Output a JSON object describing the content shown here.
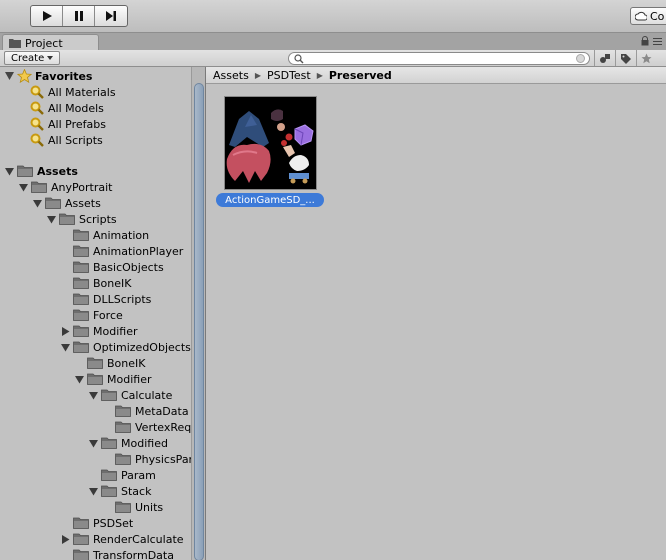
{
  "toolbar": {
    "play": "play-icon",
    "pause": "pause-icon",
    "step": "step-icon",
    "collab_label": "Co"
  },
  "tab": {
    "label": "Project"
  },
  "project_toolbar": {
    "create_label": "Create",
    "search_placeholder": ""
  },
  "favorites": {
    "label": "Favorites",
    "items": [
      {
        "label": "All Materials"
      },
      {
        "label": "All Models"
      },
      {
        "label": "All Prefabs"
      },
      {
        "label": "All Scripts"
      }
    ]
  },
  "tree": [
    {
      "label": "Assets",
      "depth": 0,
      "arrow": "open",
      "bold": true
    },
    {
      "label": "AnyPortrait",
      "depth": 1,
      "arrow": "open"
    },
    {
      "label": "Assets",
      "depth": 2,
      "arrow": "open"
    },
    {
      "label": "Scripts",
      "depth": 3,
      "arrow": "open"
    },
    {
      "label": "Animation",
      "depth": 4,
      "arrow": "none"
    },
    {
      "label": "AnimationPlayer",
      "depth": 4,
      "arrow": "none"
    },
    {
      "label": "BasicObjects",
      "depth": 4,
      "arrow": "none"
    },
    {
      "label": "BoneIK",
      "depth": 4,
      "arrow": "none"
    },
    {
      "label": "DLLScripts",
      "depth": 4,
      "arrow": "none"
    },
    {
      "label": "Force",
      "depth": 4,
      "arrow": "none"
    },
    {
      "label": "Modifier",
      "depth": 4,
      "arrow": "closed"
    },
    {
      "label": "OptimizedObjects",
      "depth": 4,
      "arrow": "open"
    },
    {
      "label": "BoneIK",
      "depth": 5,
      "arrow": "none"
    },
    {
      "label": "Modifier",
      "depth": 5,
      "arrow": "open"
    },
    {
      "label": "Calculate",
      "depth": 6,
      "arrow": "open"
    },
    {
      "label": "MetaData",
      "depth": 7,
      "arrow": "none"
    },
    {
      "label": "VertexRequest",
      "depth": 7,
      "arrow": "none"
    },
    {
      "label": "Modified",
      "depth": 6,
      "arrow": "open"
    },
    {
      "label": "PhysicsParam",
      "depth": 7,
      "arrow": "none"
    },
    {
      "label": "Param",
      "depth": 6,
      "arrow": "none"
    },
    {
      "label": "Stack",
      "depth": 6,
      "arrow": "open"
    },
    {
      "label": "Units",
      "depth": 7,
      "arrow": "none"
    },
    {
      "label": "PSDSet",
      "depth": 4,
      "arrow": "none"
    },
    {
      "label": "RenderCalculate",
      "depth": 4,
      "arrow": "closed"
    },
    {
      "label": "TransformData",
      "depth": 4,
      "arrow": "none"
    }
  ],
  "breadcrumb": [
    "Assets",
    "PSDTest",
    "Preserved"
  ],
  "asset": {
    "label": "ActionGameSD_..."
  },
  "colors": {
    "selection": "#3d7ad8",
    "panel_bg": "#c2c2c2",
    "folder": "#6e6e6e"
  }
}
